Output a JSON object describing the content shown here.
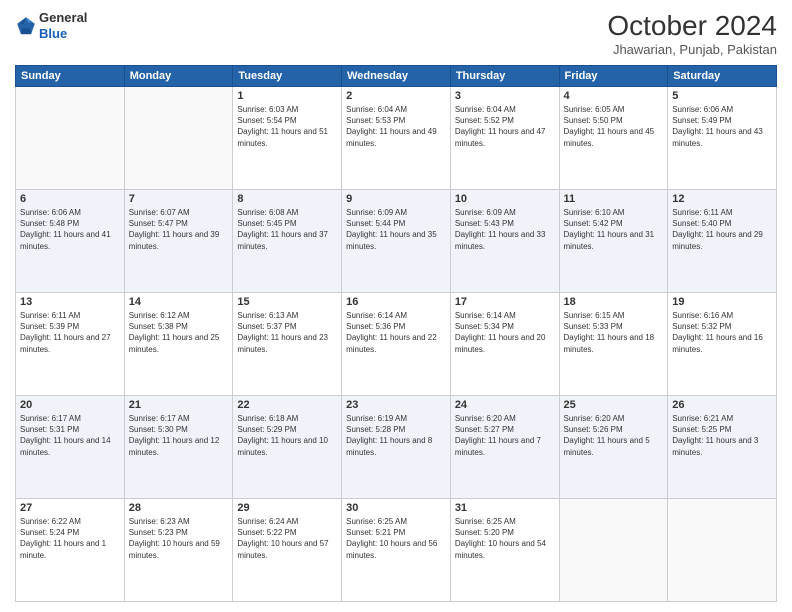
{
  "logo": {
    "general": "General",
    "blue": "Blue"
  },
  "header": {
    "month": "October 2024",
    "location": "Jhawarian, Punjab, Pakistan"
  },
  "weekdays": [
    "Sunday",
    "Monday",
    "Tuesday",
    "Wednesday",
    "Thursday",
    "Friday",
    "Saturday"
  ],
  "weeks": [
    [
      {
        "day": "",
        "sunrise": "",
        "sunset": "",
        "daylight": ""
      },
      {
        "day": "",
        "sunrise": "",
        "sunset": "",
        "daylight": ""
      },
      {
        "day": "1",
        "sunrise": "Sunrise: 6:03 AM",
        "sunset": "Sunset: 5:54 PM",
        "daylight": "Daylight: 11 hours and 51 minutes."
      },
      {
        "day": "2",
        "sunrise": "Sunrise: 6:04 AM",
        "sunset": "Sunset: 5:53 PM",
        "daylight": "Daylight: 11 hours and 49 minutes."
      },
      {
        "day": "3",
        "sunrise": "Sunrise: 6:04 AM",
        "sunset": "Sunset: 5:52 PM",
        "daylight": "Daylight: 11 hours and 47 minutes."
      },
      {
        "day": "4",
        "sunrise": "Sunrise: 6:05 AM",
        "sunset": "Sunset: 5:50 PM",
        "daylight": "Daylight: 11 hours and 45 minutes."
      },
      {
        "day": "5",
        "sunrise": "Sunrise: 6:06 AM",
        "sunset": "Sunset: 5:49 PM",
        "daylight": "Daylight: 11 hours and 43 minutes."
      }
    ],
    [
      {
        "day": "6",
        "sunrise": "Sunrise: 6:06 AM",
        "sunset": "Sunset: 5:48 PM",
        "daylight": "Daylight: 11 hours and 41 minutes."
      },
      {
        "day": "7",
        "sunrise": "Sunrise: 6:07 AM",
        "sunset": "Sunset: 5:47 PM",
        "daylight": "Daylight: 11 hours and 39 minutes."
      },
      {
        "day": "8",
        "sunrise": "Sunrise: 6:08 AM",
        "sunset": "Sunset: 5:45 PM",
        "daylight": "Daylight: 11 hours and 37 minutes."
      },
      {
        "day": "9",
        "sunrise": "Sunrise: 6:09 AM",
        "sunset": "Sunset: 5:44 PM",
        "daylight": "Daylight: 11 hours and 35 minutes."
      },
      {
        "day": "10",
        "sunrise": "Sunrise: 6:09 AM",
        "sunset": "Sunset: 5:43 PM",
        "daylight": "Daylight: 11 hours and 33 minutes."
      },
      {
        "day": "11",
        "sunrise": "Sunrise: 6:10 AM",
        "sunset": "Sunset: 5:42 PM",
        "daylight": "Daylight: 11 hours and 31 minutes."
      },
      {
        "day": "12",
        "sunrise": "Sunrise: 6:11 AM",
        "sunset": "Sunset: 5:40 PM",
        "daylight": "Daylight: 11 hours and 29 minutes."
      }
    ],
    [
      {
        "day": "13",
        "sunrise": "Sunrise: 6:11 AM",
        "sunset": "Sunset: 5:39 PM",
        "daylight": "Daylight: 11 hours and 27 minutes."
      },
      {
        "day": "14",
        "sunrise": "Sunrise: 6:12 AM",
        "sunset": "Sunset: 5:38 PM",
        "daylight": "Daylight: 11 hours and 25 minutes."
      },
      {
        "day": "15",
        "sunrise": "Sunrise: 6:13 AM",
        "sunset": "Sunset: 5:37 PM",
        "daylight": "Daylight: 11 hours and 23 minutes."
      },
      {
        "day": "16",
        "sunrise": "Sunrise: 6:14 AM",
        "sunset": "Sunset: 5:36 PM",
        "daylight": "Daylight: 11 hours and 22 minutes."
      },
      {
        "day": "17",
        "sunrise": "Sunrise: 6:14 AM",
        "sunset": "Sunset: 5:34 PM",
        "daylight": "Daylight: 11 hours and 20 minutes."
      },
      {
        "day": "18",
        "sunrise": "Sunrise: 6:15 AM",
        "sunset": "Sunset: 5:33 PM",
        "daylight": "Daylight: 11 hours and 18 minutes."
      },
      {
        "day": "19",
        "sunrise": "Sunrise: 6:16 AM",
        "sunset": "Sunset: 5:32 PM",
        "daylight": "Daylight: 11 hours and 16 minutes."
      }
    ],
    [
      {
        "day": "20",
        "sunrise": "Sunrise: 6:17 AM",
        "sunset": "Sunset: 5:31 PM",
        "daylight": "Daylight: 11 hours and 14 minutes."
      },
      {
        "day": "21",
        "sunrise": "Sunrise: 6:17 AM",
        "sunset": "Sunset: 5:30 PM",
        "daylight": "Daylight: 11 hours and 12 minutes."
      },
      {
        "day": "22",
        "sunrise": "Sunrise: 6:18 AM",
        "sunset": "Sunset: 5:29 PM",
        "daylight": "Daylight: 11 hours and 10 minutes."
      },
      {
        "day": "23",
        "sunrise": "Sunrise: 6:19 AM",
        "sunset": "Sunset: 5:28 PM",
        "daylight": "Daylight: 11 hours and 8 minutes."
      },
      {
        "day": "24",
        "sunrise": "Sunrise: 6:20 AM",
        "sunset": "Sunset: 5:27 PM",
        "daylight": "Daylight: 11 hours and 7 minutes."
      },
      {
        "day": "25",
        "sunrise": "Sunrise: 6:20 AM",
        "sunset": "Sunset: 5:26 PM",
        "daylight": "Daylight: 11 hours and 5 minutes."
      },
      {
        "day": "26",
        "sunrise": "Sunrise: 6:21 AM",
        "sunset": "Sunset: 5:25 PM",
        "daylight": "Daylight: 11 hours and 3 minutes."
      }
    ],
    [
      {
        "day": "27",
        "sunrise": "Sunrise: 6:22 AM",
        "sunset": "Sunset: 5:24 PM",
        "daylight": "Daylight: 11 hours and 1 minute."
      },
      {
        "day": "28",
        "sunrise": "Sunrise: 6:23 AM",
        "sunset": "Sunset: 5:23 PM",
        "daylight": "Daylight: 10 hours and 59 minutes."
      },
      {
        "day": "29",
        "sunrise": "Sunrise: 6:24 AM",
        "sunset": "Sunset: 5:22 PM",
        "daylight": "Daylight: 10 hours and 57 minutes."
      },
      {
        "day": "30",
        "sunrise": "Sunrise: 6:25 AM",
        "sunset": "Sunset: 5:21 PM",
        "daylight": "Daylight: 10 hours and 56 minutes."
      },
      {
        "day": "31",
        "sunrise": "Sunrise: 6:25 AM",
        "sunset": "Sunset: 5:20 PM",
        "daylight": "Daylight: 10 hours and 54 minutes."
      },
      {
        "day": "",
        "sunrise": "",
        "sunset": "",
        "daylight": ""
      },
      {
        "day": "",
        "sunrise": "",
        "sunset": "",
        "daylight": ""
      }
    ]
  ]
}
